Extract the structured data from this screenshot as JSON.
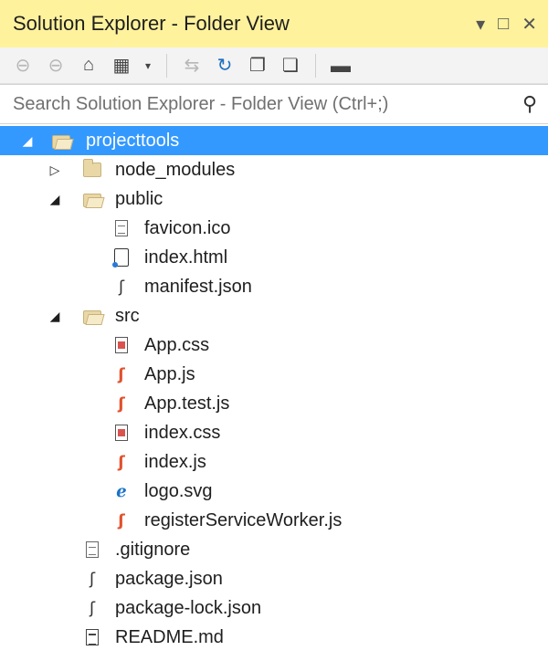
{
  "window": {
    "title": "Solution Explorer - Folder View",
    "controls": [
      "▾",
      "□",
      "✕"
    ]
  },
  "toolbar": {
    "buttons": [
      "back-icon",
      "forward-icon",
      "home-icon",
      "switch-views-icon",
      "dropdown-icon",
      "sync-icon",
      "refresh-icon",
      "collapse-all-icon",
      "show-all-files-icon",
      "properties-icon"
    ]
  },
  "search": {
    "placeholder": "Search Solution Explorer - Folder View (Ctrl+;)"
  },
  "tree": {
    "root": "projecttools",
    "items": [
      {
        "label": "node_modules"
      },
      {
        "label": "public"
      },
      {
        "label": "favicon.ico"
      },
      {
        "label": "index.html"
      },
      {
        "label": "manifest.json"
      },
      {
        "label": "src"
      },
      {
        "label": "App.css"
      },
      {
        "label": "App.js"
      },
      {
        "label": "App.test.js"
      },
      {
        "label": "index.css"
      },
      {
        "label": "index.js"
      },
      {
        "label": "logo.svg"
      },
      {
        "label": "registerServiceWorker.js"
      },
      {
        "label": ".gitignore"
      },
      {
        "label": "package.json"
      },
      {
        "label": "package-lock.json"
      },
      {
        "label": "README.md"
      }
    ]
  },
  "colors": {
    "titlebar": "#fff29d",
    "selection": "#3399ff"
  }
}
